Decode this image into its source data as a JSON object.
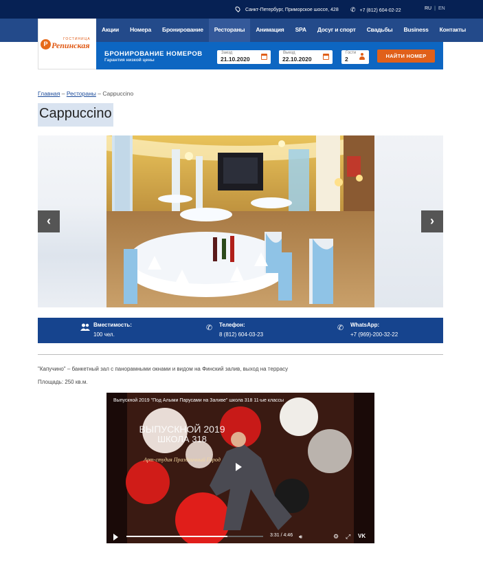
{
  "topbar": {
    "address": "Санкт-Петербург, Приморское шоссе, 428",
    "phone": "+7 (812) 604-02-22",
    "lang_ru": "RU",
    "lang_sep": "|",
    "lang_en": "EN"
  },
  "logo": {
    "small": "ГОСТИНИЦА",
    "big": "Репинская"
  },
  "nav": {
    "items": [
      "Акции",
      "Номера",
      "Бронирование",
      "Рестораны",
      "Анимация",
      "SPA",
      "Досуг и спорт",
      "Свадьбы",
      "Business",
      "Контакты"
    ]
  },
  "booking": {
    "title": "БРОНИРОВАНИЕ НОМЕРОВ",
    "subtitle": "Гарантия низкой цены",
    "checkin_label": "Заезд",
    "checkin_value": "21.10.2020",
    "checkout_label": "Выезд",
    "checkout_value": "22.10.2020",
    "guests_label": "Гости",
    "guests_value": "2",
    "find_button": "НАЙТИ НОМЕР"
  },
  "breadcrumb": {
    "home": "Главная",
    "sep1": " – ",
    "section": "Рестораны",
    "sep2": " – ",
    "current": "Cappuccino"
  },
  "page_title": "Cappuccino",
  "slider": {
    "prev": "‹",
    "next": "›"
  },
  "info": {
    "capacity_label": "Вместимость:",
    "capacity_value": "100 чел.",
    "phone_label": "Телефон:",
    "phone_value": "8 (812) 604-03-23",
    "whatsapp_label": "WhatsApp:",
    "whatsapp_value": "+7 (969)-200-32-22"
  },
  "description": "\"Капучино\" – банкетный зал с панорамными окнами и видом на Финский залив, выход на террасу",
  "area": "Площадь: 250 кв.м.",
  "video": {
    "title": "Выпускной 2019 \"Под Алыми Парусами на Заливе\" школа 318 11-ые классы",
    "overlay_line1": "ВЫПУСКНОЙ 2019",
    "overlay_line2": "ШКОЛА 318",
    "overlay_studio": "Арт-студия Праздничный Город",
    "time": "3:31 / 4:46",
    "progress": 0.74,
    "vk_label": "VK"
  },
  "colors": {
    "topbar": "#062154",
    "nav": "#234a8a",
    "booking": "#0d66c2",
    "accent": "#e0601a",
    "infobar": "#16448e"
  }
}
